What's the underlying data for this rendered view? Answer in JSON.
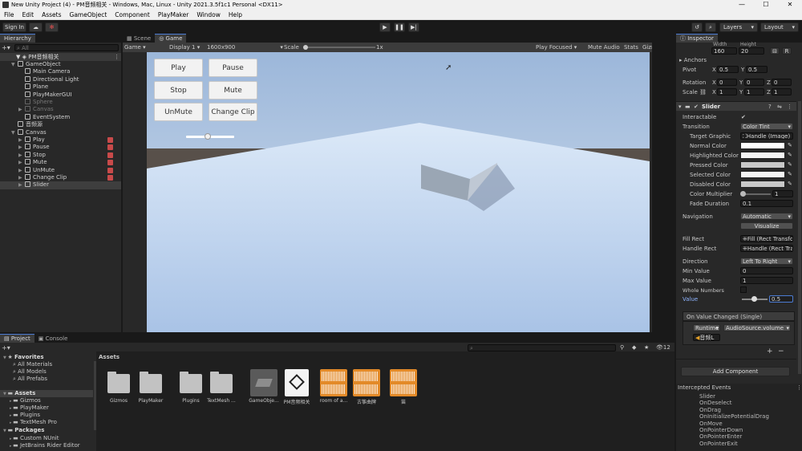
{
  "window": {
    "title": "New Unity Project (4) - PM音频相关 - Windows, Mac, Linux - Unity 2021.3.5f1c1 Personal <DX11>"
  },
  "menu": [
    "File",
    "Edit",
    "Assets",
    "GameObject",
    "Component",
    "PlayMaker",
    "Window",
    "Help"
  ],
  "toolbar": {
    "sign_in": "Sign In",
    "layers": "Layers",
    "layout": "Layout"
  },
  "hierarchy": {
    "tab": "Hierarchy",
    "search_placeholder": "All",
    "scene": "PM音频相关",
    "items": [
      {
        "label": "GameObject",
        "depth": 1,
        "expanded": true
      },
      {
        "label": "Main Camera",
        "depth": 2
      },
      {
        "label": "Directional Light",
        "depth": 2
      },
      {
        "label": "Plane",
        "depth": 2
      },
      {
        "label": "PlayMakerGUI",
        "depth": 2
      },
      {
        "label": "Sphere",
        "depth": 2,
        "dim": true
      },
      {
        "label": "Canvas",
        "depth": 2,
        "dim": true,
        "collapsed": true
      },
      {
        "label": "EventSystem",
        "depth": 2
      },
      {
        "label": "音频源",
        "depth": 1
      },
      {
        "label": "Canvas",
        "depth": 1,
        "expanded": true
      },
      {
        "label": "Play",
        "depth": 2,
        "collapsed": true,
        "pm": true
      },
      {
        "label": "Pause",
        "depth": 2,
        "collapsed": true,
        "pm": true
      },
      {
        "label": "Stop",
        "depth": 2,
        "collapsed": true,
        "pm": true
      },
      {
        "label": "Mute",
        "depth": 2,
        "collapsed": true,
        "pm": true
      },
      {
        "label": "UnMute",
        "depth": 2,
        "collapsed": true,
        "pm": true
      },
      {
        "label": "Change Clip",
        "depth": 2,
        "collapsed": true,
        "pm": true
      },
      {
        "label": "Slider",
        "depth": 2,
        "collapsed": true,
        "selected": true
      }
    ]
  },
  "scene_tabs": {
    "scene": "Scene",
    "game": "Game"
  },
  "game_toolbar": {
    "mode": "Game",
    "display": "Display 1",
    "resolution": "1600x900",
    "scale_label": "Scale",
    "scale_value": "1x",
    "play_focused": "Play Focused",
    "mute_audio": "Mute Audio",
    "stats": "Stats",
    "gizmos": "Gizmos"
  },
  "game_buttons": {
    "play": "Play",
    "pause": "Pause",
    "stop": "Stop",
    "mute": "Mute",
    "unmute": "UnMute",
    "change_clip": "Change Clip"
  },
  "game_slider_value": 0.45,
  "inspector": {
    "tab": "Inspector",
    "width_label": "Width",
    "height_label": "Height",
    "width": "160",
    "height": "20",
    "anchors": "Anchors",
    "pivot_label": "Pivot",
    "pivot_x": "0.5",
    "pivot_y": "0.5",
    "rotation_label": "Rotation",
    "rot_x": "0",
    "rot_y": "0",
    "rot_z": "0",
    "scale_label": "Scale",
    "scale_x": "1",
    "scale_y": "1",
    "scale_z": "1",
    "component_title": "Slider",
    "interactable": "Interactable",
    "transition": "Transition",
    "transition_value": "Color Tint",
    "target_graphic": "Target Graphic",
    "target_graphic_value": "Handle (Image)",
    "normal_color": "Normal Color",
    "highlighted_color": "Highlighted Color",
    "pressed_color": "Pressed Color",
    "selected_color": "Selected Color",
    "disabled_color": "Disabled Color",
    "color_multiplier": "Color Multiplier",
    "color_multiplier_value": "1",
    "fade_duration": "Fade Duration",
    "fade_duration_value": "0.1",
    "navigation": "Navigation",
    "navigation_value": "Automatic",
    "visualize": "Visualize",
    "fill_rect": "Fill Rect",
    "fill_rect_value": "Fill (Rect Transform)",
    "handle_rect": "Handle Rect",
    "handle_rect_value": "Handle (Rect Transform)",
    "direction": "Direction",
    "direction_value": "Left To Right",
    "min_value": "Min Value",
    "min_value_value": "0",
    "max_value": "Max Value",
    "max_value_value": "1",
    "whole_numbers": "Whole Numbers",
    "value": "Value",
    "value_value": "0.5",
    "on_value_changed": "On Value Changed (Single)",
    "runtime": "Runtime",
    "function": "AudioSource.volume",
    "target_obj": "音频L",
    "add_component": "Add Component",
    "intercepted_events": "Intercepted Events",
    "events": [
      "Slider",
      "OnDeselect",
      "OnDrag",
      "OnInitializePotentialDrag",
      "OnMove",
      "OnPointerDown",
      "OnPointerEnter",
      "OnPointerExit"
    ]
  },
  "project": {
    "tab_project": "Project",
    "tab_console": "Console",
    "favorites": "Favorites",
    "fav_items": [
      "All Materials",
      "All Models",
      "All Prefabs"
    ],
    "assets_root": "Assets",
    "asset_folders": [
      "Gizmos",
      "PlayMaker",
      "Plugins",
      "TextMesh Pro"
    ],
    "packages": "Packages",
    "package_items": [
      "Custom NUnit",
      "JetBrains Rider Editor"
    ],
    "breadcrumb": "Assets",
    "hidden_count": "12",
    "assets": [
      {
        "label": "Gizmos",
        "type": "folder"
      },
      {
        "label": "PlayMaker",
        "type": "folder"
      },
      {
        "label": "Plugins",
        "type": "folder"
      },
      {
        "label": "TextMesh ...",
        "type": "folder"
      },
      {
        "label": "GameObje...",
        "type": "prefab"
      },
      {
        "label": "PM音频相关",
        "type": "scene"
      },
      {
        "label": "room of a...",
        "type": "audio"
      },
      {
        "label": "古筝曲牌",
        "type": "audio"
      },
      {
        "label": "笛",
        "type": "audio"
      }
    ]
  },
  "colors": {
    "accent": "#4b7bd3",
    "sky": "#afc8e8",
    "ground": "#d8e7f8",
    "horizon": "#5a4e46",
    "audio": "#e38a28"
  }
}
